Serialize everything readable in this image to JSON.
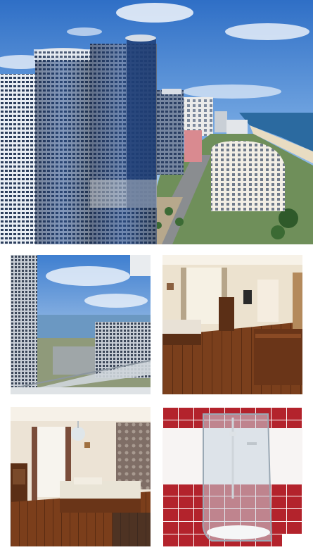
{
  "gallery": {
    "photos": [
      {
        "id": "hero",
        "subject": "city-skyline-aerial-view"
      },
      {
        "id": "balcony",
        "subject": "balcony-sea-view"
      },
      {
        "id": "room",
        "subject": "hotel-room-tv-desk"
      },
      {
        "id": "bedroom",
        "subject": "hotel-bedroom-chandelier"
      },
      {
        "id": "bathroom",
        "subject": "bathroom-shower-cabin"
      }
    ]
  },
  "palette": {
    "sky": "#3f7fd0",
    "sea": "#2b6aa0",
    "wood": "#6b3a1c",
    "tile_red": "#b3232c",
    "glass": "#1e3a68"
  }
}
